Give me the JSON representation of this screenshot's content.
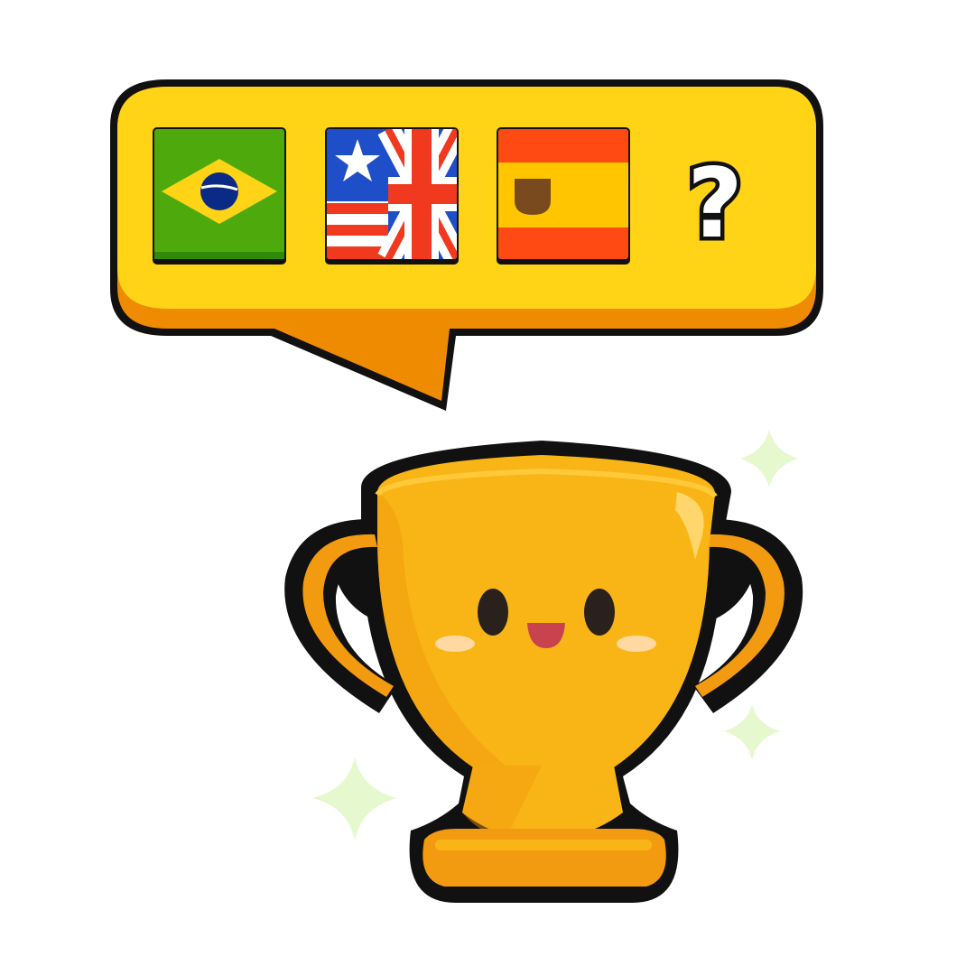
{
  "bubble": {
    "question_mark": "?",
    "flags": [
      {
        "icon": "brazil-flag-icon"
      },
      {
        "icon": "usa-uk-flag-icon"
      },
      {
        "icon": "spain-flag-icon"
      }
    ]
  },
  "trophy": {
    "icon": "trophy-mascot-icon"
  },
  "colors": {
    "bubble_yellow": "#FFD316",
    "bubble_shadow": "#EE8B00",
    "outline": "#111111",
    "trophy_gold": "#F9B515",
    "trophy_orange": "#F29A10",
    "sparkle_green": "#E6F8CE"
  }
}
